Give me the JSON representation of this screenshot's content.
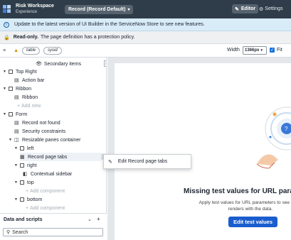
{
  "topbar": {
    "app_title": "Risk Workspace",
    "app_subtitle": "Experience",
    "record_dropdown": "Record (Record Default)",
    "editor_label": "Editor",
    "settings_label": "Settings"
  },
  "banners": {
    "info": "Update to the latest version of UI Builder in the ServiceNow Store to see new features.",
    "readonly_bold": "Read-only.",
    "readonly_text": "The page definition has a protection policy."
  },
  "toolbar": {
    "pill_table": "table",
    "pill_sysid": "sysid",
    "width_label": "Width",
    "width_value": "1366px",
    "fit_label": "Fit",
    "fit_checked": true
  },
  "sidebar": {
    "secondary_items": "Secondary items",
    "tree": [
      {
        "label": "Top Right",
        "kind": "node"
      },
      {
        "label": "Action bar",
        "kind": "leaf"
      },
      {
        "label": "Ribbon",
        "kind": "node"
      },
      {
        "label": "Ribbon",
        "kind": "leaf"
      },
      {
        "label": "Add new",
        "kind": "add"
      },
      {
        "label": "Form",
        "kind": "node"
      },
      {
        "label": "Record not found",
        "kind": "leaf"
      },
      {
        "label": "Security constraints",
        "kind": "leaf"
      },
      {
        "label": "Resizable panes container",
        "kind": "container"
      },
      {
        "label": "left",
        "kind": "slot"
      },
      {
        "label": "Record page tabs",
        "kind": "leaf"
      },
      {
        "label": "right",
        "kind": "slot"
      },
      {
        "label": "Contextual sidebar",
        "kind": "leaf"
      },
      {
        "label": "top",
        "kind": "slot"
      },
      {
        "label": "Add component",
        "kind": "add"
      },
      {
        "label": "bottom",
        "kind": "slot"
      },
      {
        "label": "Add component",
        "kind": "add"
      }
    ]
  },
  "data_scripts": {
    "title": "Data and scripts",
    "search_placeholder": "Search"
  },
  "context_menu": {
    "item": "Edit Record page tabs"
  },
  "canvas": {
    "title": "Missing test values for URL parame",
    "subtitle_line1": "Apply test values for URL parameters to see how t",
    "subtitle_line2": "renders with the data.",
    "button": "Edit test values"
  },
  "colors": {
    "topbar": "#2e3d49",
    "info_banner": "#d8ecf8",
    "primary_button": "#1a5dcf"
  }
}
